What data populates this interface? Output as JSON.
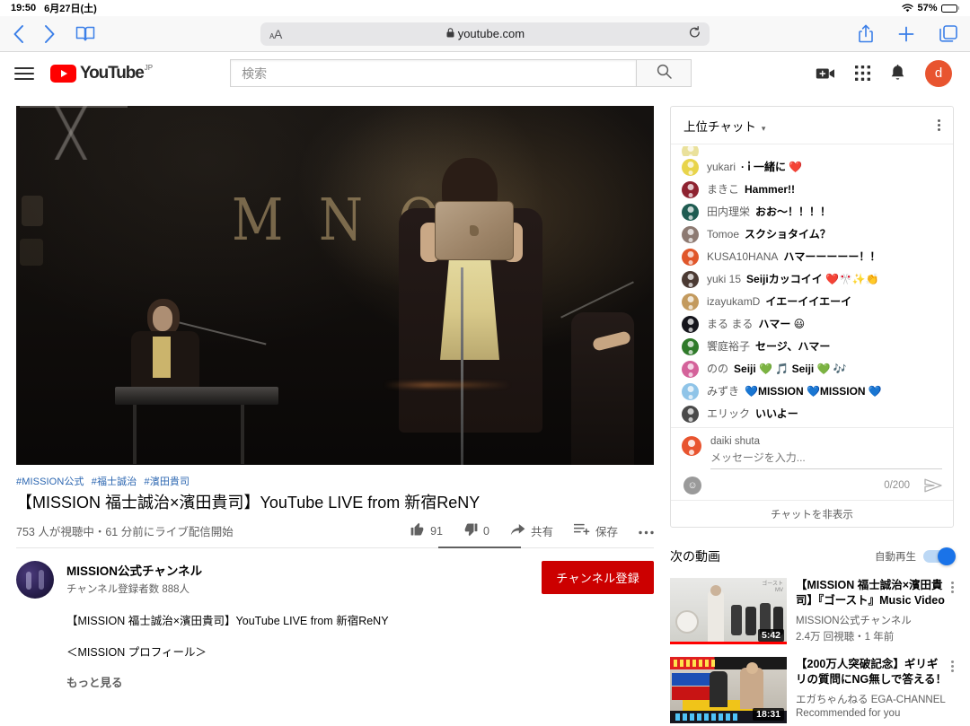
{
  "status_bar": {
    "time": "19:50",
    "date": "6月27日(土)",
    "battery_percent": "57%",
    "battery_level": 57
  },
  "safari": {
    "aa_label": "ᴀA",
    "url": "youtube.com",
    "lock_icon": "lock-icon",
    "reload_icon": "reload-icon",
    "back_icon": "back-chevron-icon",
    "forward_icon": "forward-chevron-icon",
    "bookmarks_icon": "bookmarks-icon",
    "share_icon": "share-icon",
    "new_tab_icon": "plus-icon",
    "tabs_icon": "tabs-icon"
  },
  "masthead": {
    "menu_icon": "hamburger-menu-icon",
    "logo_text": "YouTube",
    "logo_country": "JP",
    "search_placeholder": "検索",
    "search_value": "",
    "search_icon": "search-icon",
    "create_icon": "video-camera-icon",
    "apps_icon": "apps-grid-icon",
    "notifications_icon": "bell-icon",
    "account_initial": "d",
    "account_color": "#e8542f"
  },
  "video": {
    "tags": [
      "#MISSION公式",
      "#福士誠治",
      "#濱田貴司"
    ],
    "title": "【MISSION 福士誠治×濱田貴司】YouTube LIVE from 新宿ReNY",
    "stats": "753 人が視聴中・61 分前にライブ配信開始",
    "like_count": "91",
    "dislike_count": "0",
    "share_label": "共有",
    "save_label": "保存",
    "more_label": "…",
    "like_icon": "thumbs-up-icon",
    "dislike_icon": "thumbs-down-icon",
    "share_icon": "share-arrow-icon",
    "save_icon": "save-playlist-icon",
    "stage_logo_text": "MISSION"
  },
  "channel": {
    "name": "MISSION公式チャンネル",
    "subscribers": "チャンネル登録者数 888人",
    "subscribe_label": "チャンネル登録",
    "subscribe_color": "#cc0000",
    "description_lines": [
      "【MISSION 福士誠治×濱田貴司】YouTube LIVE from 新宿ReNY",
      "＜MISSION プロフィール＞"
    ],
    "show_more_label": "もっと見る"
  },
  "chat": {
    "mode_label": "上位チャット",
    "caret_icon": "chevron-down-icon",
    "menu_icon": "kebab-menu-icon",
    "messages": [
      {
        "name": "",
        "text": "",
        "color": "#d9c94b",
        "cut": true
      },
      {
        "name": "yukari",
        "text": "· i̇ 一緒に ❤️",
        "color": "#e8d44a"
      },
      {
        "name": "まきこ",
        "text": "Hammer!!",
        "color": "#8e2230"
      },
      {
        "name": "田内理栄",
        "text": "おお〜！！！！",
        "color": "#1f5c52"
      },
      {
        "name": "Tomoe",
        "text": "スクショタイム？",
        "color": "#8d7a72"
      },
      {
        "name": "KUSA10HANA",
        "text": "ハマーーーーー！！",
        "color": "#e0562a"
      },
      {
        "name": "yuki 15",
        "text": "Seijiカッコイイ ❤️🎌✨👏",
        "color": "#4b3a33"
      },
      {
        "name": "izayukamD",
        "text": "イエーイイエーイ",
        "color": "#c39a5e"
      },
      {
        "name": "まる まる",
        "text": "ハマー 😃",
        "color": "#15151c"
      },
      {
        "name": "饗庭裕子",
        "text": "セージ、ハマー",
        "color": "#2f7a2a"
      },
      {
        "name": "のの",
        "text": "Seiji 💚 🎵 Seiji 💚 🎶",
        "color": "#d4629a"
      },
      {
        "name": "みずき",
        "text": "💙MISSION 💙MISSION 💙",
        "color": "#8fc4e8"
      },
      {
        "name": "エリック",
        "text": "いいよー",
        "color": "#4a4a4a"
      }
    ],
    "input": {
      "user": "daiki shuta",
      "avatar_color": "#e8542f",
      "placeholder": "メッセージを入力...",
      "value": "",
      "counter": "0/200",
      "emoji_icon": "emoji-smiley-icon",
      "send_icon": "send-arrow-icon"
    },
    "hide_label": "チャットを非表示"
  },
  "up_next": {
    "title": "次の動画",
    "autoplay_label": "自動再生",
    "autoplay_on": true,
    "videos": [
      {
        "title": "【MISSION 福士誠治×濱田貴司】『ゴースト』Music Video",
        "channel": "MISSION公式チャンネル",
        "meta": "2.4万 回視聴・1 年前",
        "duration": "5:42",
        "menu_icon": "kebab-menu-icon"
      },
      {
        "title": "【200万人突破記念】ギリギリの質問にNG無しで答える！",
        "channel": "エガちゃんねる EGA-CHANNEL",
        "meta": "Recommended for you",
        "duration": "18:31",
        "menu_icon": "kebab-menu-icon"
      }
    ]
  }
}
